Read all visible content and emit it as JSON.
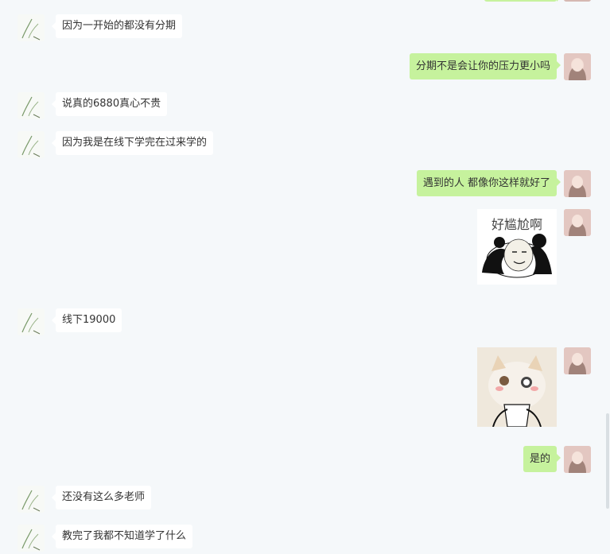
{
  "colors": {
    "background": "#f5f8fa",
    "bubble_self": "#c6f29d",
    "bubble_other": "#ffffff"
  },
  "messages": [
    {
      "side": "left",
      "text": "因为一开始的都没有分期"
    },
    {
      "side": "right",
      "text": "分期不是会让你的压力更小吗"
    },
    {
      "side": "left",
      "text": "说真的6880真心不贵"
    },
    {
      "side": "left",
      "text": "因为我是在线下学完在过来学的"
    },
    {
      "side": "right",
      "text": "遇到的人 都像你这样就好了"
    },
    {
      "side": "right",
      "type": "sticker",
      "text": "好尴尬啊",
      "icon": "panda-meme-sticker"
    },
    {
      "side": "left",
      "text": "线下19000"
    },
    {
      "side": "right",
      "type": "image",
      "icon": "cat-meme-image"
    },
    {
      "side": "right",
      "text": "是的"
    },
    {
      "side": "left",
      "text": "还没有这么多老师"
    },
    {
      "side": "left",
      "text": "教完了我都不知道学了什么"
    }
  ]
}
